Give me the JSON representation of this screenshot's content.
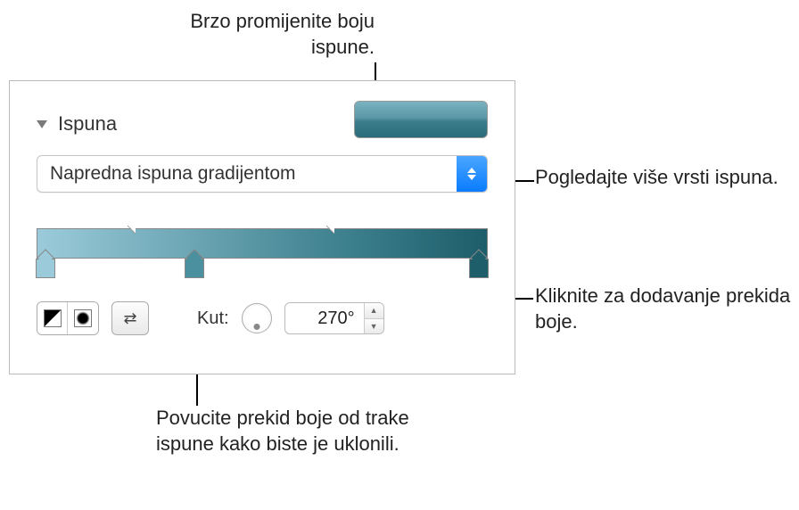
{
  "callouts": {
    "top": "Brzo promijenite boju ispune.",
    "right1": "Pogledajte više vrsti ispuna.",
    "right2": "Kliknite za dodavanje prekida boje.",
    "bottom": "Povucite prekid boje od trake ispune kako biste je uklonili."
  },
  "panel": {
    "section_title": "Ispuna",
    "fill_type": "Napredna ispuna gradijentom",
    "angle_label": "Kut:",
    "angle_value": "270°",
    "gradient": {
      "stops": [
        {
          "pos": 0.02,
          "color": "#9bcbda"
        },
        {
          "pos": 0.35,
          "color": "#4a909e"
        },
        {
          "pos": 0.98,
          "color": "#1e5d6a"
        }
      ],
      "midpoints": [
        0.22,
        0.66
      ]
    },
    "swatch_gradient": [
      "#7ab2c0",
      "#2b6b7a"
    ]
  }
}
